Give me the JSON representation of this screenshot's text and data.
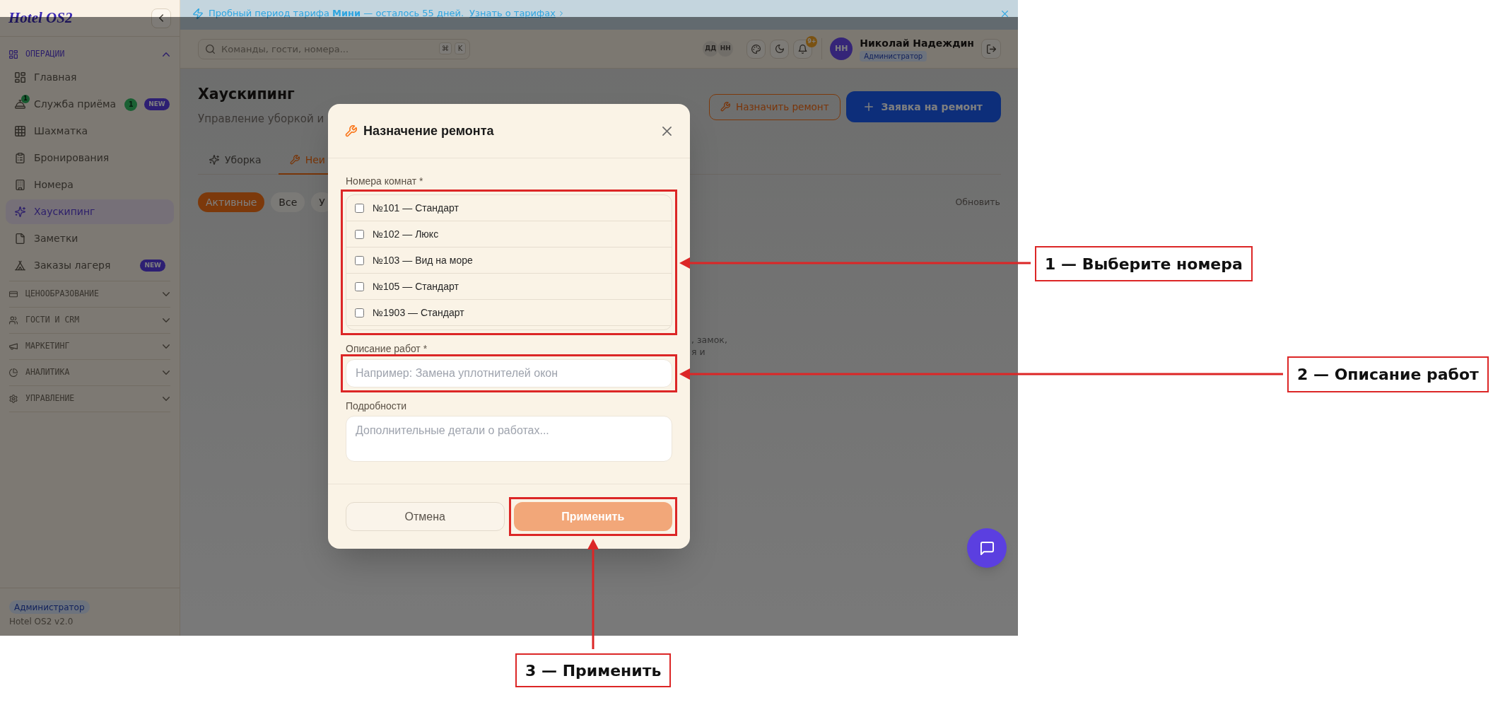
{
  "banner": {
    "text": "Пробный период тарифа **Мини** — осталось 55 дней.",
    "link": "Узнать о тарифах"
  },
  "sidebar": {
    "logo": "Hotel OS2",
    "sections": [
      {
        "label": "ОПЕРАЦИИ",
        "expanded": true,
        "items": [
          {
            "label": "Главная",
            "selected": false
          },
          {
            "label": "Служба приёма",
            "selected": false,
            "icon_badge": "1",
            "count": "1",
            "tag": "NEW"
          },
          {
            "label": "Шахматка",
            "selected": false
          },
          {
            "label": "Бронирования",
            "selected": false
          },
          {
            "label": "Номера",
            "selected": false
          },
          {
            "label": "Хаускипинг",
            "selected": true
          },
          {
            "label": "Заметки",
            "selected": false
          },
          {
            "label": "Заказы лагеря",
            "selected": false,
            "tag": "NEW"
          }
        ]
      },
      {
        "label": "ЦЕНООБРАЗОВАНИЕ",
        "expanded": false
      },
      {
        "label": "ГОСТИ И CRM",
        "expanded": false
      },
      {
        "label": "МАРКЕТИНГ",
        "expanded": false
      },
      {
        "label": "АНАЛИТИКА",
        "expanded": false
      },
      {
        "label": "УПРАВЛЕНИЕ",
        "expanded": false
      }
    ],
    "role": "Администратор",
    "version": "Hotel OS2 v2.0"
  },
  "topbar": {
    "search": {
      "placeholder": "Команды, гости, номера...",
      "keys": [
        "⌘",
        "K"
      ]
    },
    "presence": [
      "ДД",
      "НН"
    ],
    "notifications": "9+",
    "user": {
      "initials": "НН",
      "name": "Николай Надеждин",
      "role": "Администратор"
    }
  },
  "page": {
    "title": "Хаускипинг",
    "subtitle": "Управление уборкой и",
    "actions": [
      {
        "label": "Назначить ремонт",
        "kind": "outline"
      },
      {
        "label": "Заявка на ремонт",
        "kind": "primary"
      }
    ],
    "tabs": [
      {
        "label": "Уборка",
        "selected": false
      },
      {
        "label": "Неи",
        "selected": true
      }
    ],
    "filters": [
      {
        "label": "Активные",
        "selected": true
      },
      {
        "label": "Все",
        "selected": false
      },
      {
        "label": "У",
        "selected": false
      }
    ],
    "refresh": "Обновить",
    "empty_state": [
      ", замок,",
      "я и"
    ]
  },
  "dialog": {
    "title": "Назначение ремонта",
    "fields": [
      {
        "kind": "checklist",
        "label": "Номера комнат *",
        "highlighted": true,
        "options": [
          {
            "label": "№101 — Стандарт",
            "checked": false
          },
          {
            "label": "№102 — Люкс",
            "checked": false
          },
          {
            "label": "№103 — Вид на море",
            "checked": false
          },
          {
            "label": "№105 — Стандарт",
            "checked": false
          },
          {
            "label": "№1903 — Стандарт",
            "checked": false
          }
        ]
      },
      {
        "kind": "input",
        "label": "Описание работ *",
        "placeholder": "Например: Замена уплотнителей окон",
        "highlighted": true
      },
      {
        "kind": "textarea",
        "label": "Подробности",
        "placeholder": "Дополнительные детали о работах...",
        "highlighted": false
      }
    ],
    "buttons": [
      {
        "label": "Отмена",
        "kind": "secondary",
        "disabled": false,
        "highlighted": false
      },
      {
        "label": "Применить",
        "kind": "primary",
        "disabled": true,
        "highlighted": true
      }
    ]
  },
  "annotations": [
    {
      "label": "1 — Выберите номера"
    },
    {
      "label": "2 — Описание работ"
    },
    {
      "label": "3 — Применить"
    }
  ]
}
